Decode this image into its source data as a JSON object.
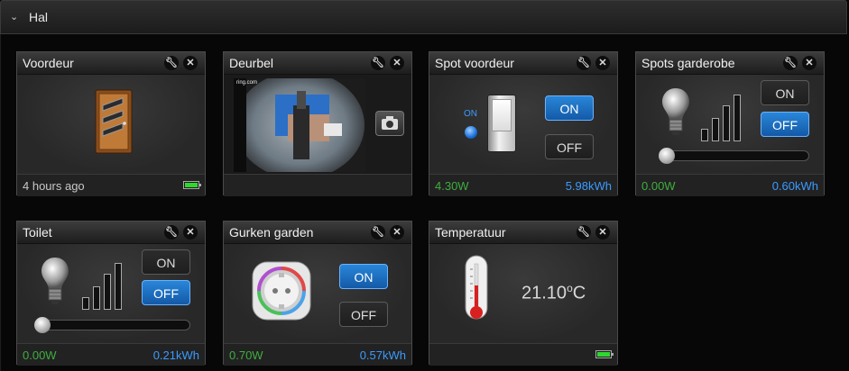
{
  "section": {
    "title": "Hal",
    "chevron_icon": "chevron-down-icon"
  },
  "tiles": {
    "voordeur": {
      "name": "Voordeur",
      "status": "4 hours ago",
      "battery_level": 1.0,
      "icon": "door-icon"
    },
    "deurbel": {
      "name": "Deurbel",
      "camera_icon": "camera-icon",
      "camera_brand": "ring.com"
    },
    "spot_voordeur": {
      "name": "Spot voordeur",
      "on_indicator": "ON",
      "on_label": "ON",
      "off_label": "OFF",
      "power": "4.30W",
      "energy": "5.98kWh",
      "active": "on"
    },
    "spots_garderobe": {
      "name": "Spots garderobe",
      "on_label": "ON",
      "off_label": "OFF",
      "power": "0.00W",
      "energy": "0.60kWh",
      "active": "off",
      "dim_level": 0
    },
    "toilet": {
      "name": "Toilet",
      "on_label": "ON",
      "off_label": "OFF",
      "power": "0.00W",
      "energy": "0.21kWh",
      "active": "off",
      "dim_level": 0
    },
    "gurken_garden": {
      "name": "Gurken garden",
      "on_label": "ON",
      "off_label": "OFF",
      "power": "0.70W",
      "energy": "0.57kWh",
      "active": "on"
    },
    "temperatuur": {
      "name": "Temperatuur",
      "value": "21.10",
      "unit_degree": "o",
      "unit": "C",
      "battery_level": 1.0
    }
  },
  "colors": {
    "accent_blue": "#3a9bff",
    "power_green": "#3fae3f",
    "button_on": "#1e72c4"
  }
}
